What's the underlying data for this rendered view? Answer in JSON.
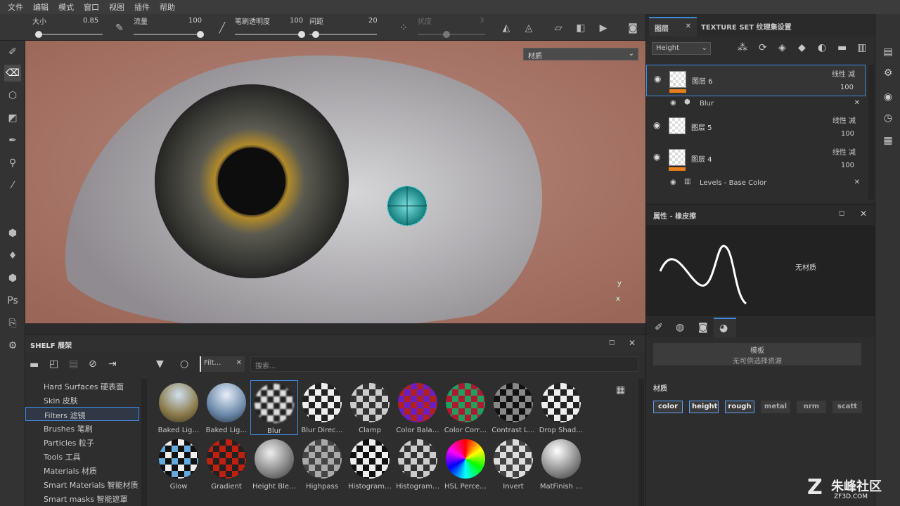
{
  "menu": [
    "文件",
    "编辑",
    "模式",
    "窗口",
    "视图",
    "插件",
    "帮助"
  ],
  "toolbar": {
    "size_label": "大小",
    "size_value": "0.85",
    "flow_label": "流量",
    "flow_value": "100",
    "opacity_label": "笔刷透明度",
    "opacity_value": "100",
    "spacing_label": "间距",
    "spacing_value": "20",
    "jitter_label": "扰度",
    "jitter_value": "3"
  },
  "viewport": {
    "material_select": "材质"
  },
  "shelf": {
    "title": "SHELF 展架",
    "filter_chip": "Filt…",
    "search_placeholder": "搜索...",
    "categories": [
      "Hard Surfaces 硬表面",
      "Skin 皮肤",
      "Filters 滤镜",
      "Brushes 笔刷",
      "Particles 粒子",
      "Tools 工具",
      "Materials 材质",
      "Smart Materials 智能材质",
      "Smart masks 智能遮罩"
    ],
    "row1": [
      "Baked Lig…",
      "Baked Lig…",
      "Blur",
      "Blur Direc…",
      "Clamp",
      "Color Bala…",
      "Color Corr…",
      "Contrast L…",
      "Drop Shad…"
    ],
    "row2": [
      "Glow",
      "Gradient",
      "Height Ble…",
      "Highpass",
      "Histogram…",
      "Histogram…",
      "HSL Perce…",
      "Invert",
      "MatFinish …"
    ]
  },
  "layers": {
    "tab_layers": "图层",
    "tab_texture": "TEXTURE SET 纹理集设置",
    "channel": "Height",
    "blend": "线性 减",
    "items": [
      {
        "name": "图层 6",
        "opacity": "100"
      },
      {
        "name": "图层 5",
        "opacity": "100"
      },
      {
        "name": "图层 4",
        "opacity": "100"
      }
    ],
    "fx1": "Blur",
    "fx2": "Levels - Base Color"
  },
  "properties": {
    "title": "属性 - 橡皮擦",
    "no_material": "无材质",
    "template_title": "模板",
    "template_sub": "无可供选择资源",
    "material_label": "材质",
    "channels": [
      "color",
      "height",
      "rough",
      "metal",
      "nrm",
      "scatt"
    ]
  },
  "watermark": {
    "brand": "朱峰社区",
    "url": "ZF3D.COM"
  }
}
